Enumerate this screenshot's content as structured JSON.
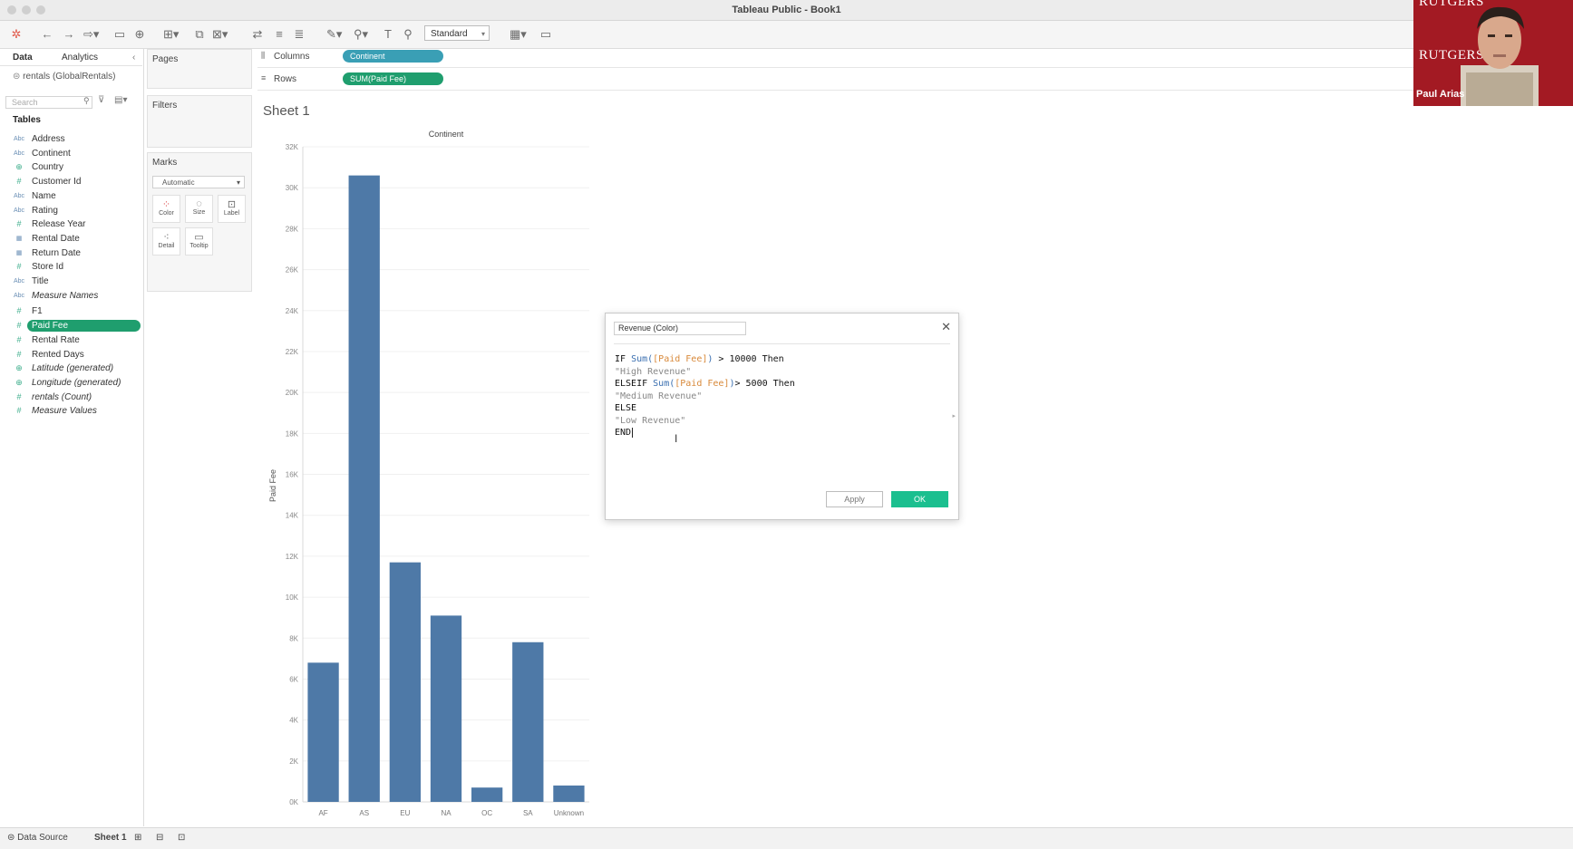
{
  "window": {
    "title": "Tableau Public - Book1"
  },
  "toolbar": {
    "view_select": "Standard"
  },
  "left_pane": {
    "tabs": [
      "Data",
      "Analytics"
    ],
    "data_source": "rentals (GlobalRentals)",
    "search_placeholder": "Search",
    "tables_heading": "Tables",
    "fields": [
      {
        "label": "Address",
        "icon": "Abc"
      },
      {
        "label": "Continent",
        "icon": "Abc"
      },
      {
        "label": "Country",
        "icon": "globe"
      },
      {
        "label": "Customer Id",
        "icon": "#"
      },
      {
        "label": "Name",
        "icon": "Abc"
      },
      {
        "label": "Rating",
        "icon": "Abc"
      },
      {
        "label": "Release Year",
        "icon": "#"
      },
      {
        "label": "Rental Date",
        "icon": "calendar"
      },
      {
        "label": "Return Date",
        "icon": "calendar"
      },
      {
        "label": "Store Id",
        "icon": "#"
      },
      {
        "label": "Title",
        "icon": "Abc"
      },
      {
        "label": "Measure Names",
        "icon": "Abc"
      },
      {
        "label": "F1",
        "icon": "#"
      },
      {
        "label": "Paid Fee",
        "icon": "#"
      },
      {
        "label": "Rental Rate",
        "icon": "#"
      },
      {
        "label": "Rented Days",
        "icon": "#"
      },
      {
        "label": "Latitude (generated)",
        "icon": "globe"
      },
      {
        "label": "Longitude (generated)",
        "icon": "globe"
      },
      {
        "label": "rentals (Count)",
        "icon": "#"
      },
      {
        "label": "Measure Values",
        "icon": "#"
      }
    ]
  },
  "shelves": {
    "pages": "Pages",
    "filters": "Filters",
    "marks": "Marks",
    "marks_type": "Automatic",
    "mark_buttons": [
      "Color",
      "Size",
      "Label",
      "Detail",
      "Tooltip"
    ],
    "columns_label": "Columns",
    "columns_pill": "Continent",
    "rows_label": "Rows",
    "rows_pill": "SUM(Paid Fee)"
  },
  "sheet": {
    "title": "Sheet 1"
  },
  "chart_data": {
    "type": "bar",
    "title": "Continent",
    "xlabel": "",
    "ylabel": "Paid Fee",
    "categories": [
      "AF",
      "AS",
      "EU",
      "NA",
      "OC",
      "SA",
      "Unknown"
    ],
    "values": [
      6800,
      30600,
      11700,
      9100,
      700,
      7800,
      800
    ],
    "ylim": [
      0,
      32000
    ],
    "yticks": [
      "0K",
      "2K",
      "4K",
      "6K",
      "8K",
      "10K",
      "12K",
      "14K",
      "16K",
      "18K",
      "20K",
      "22K",
      "24K",
      "26K",
      "28K",
      "30K",
      "32K"
    ],
    "bar_color": "#4e79a7",
    "grid": true
  },
  "dialog": {
    "name": "Revenue (Color)",
    "code_lines": [
      "IF Sum([Paid Fee]) > 10000 Then",
      "\"High Revenue\"",
      "ELSEIF Sum([Paid Fee])> 5000 Then",
      "\"Medium Revenue\"",
      "ELSE",
      "\"Low Revenue\"",
      "END"
    ],
    "apply": "Apply",
    "ok": "OK"
  },
  "webcam": {
    "name": "Paul Arias",
    "brand": "RUTGERS"
  },
  "bottom_tabs": {
    "data_source": "Data Source",
    "sheet": "Sheet 1"
  },
  "colors": {
    "accent": "#1bbf8f",
    "columns_pill": "#3a9fb5",
    "rows_pill": "#1f9e6e",
    "bar": "#4e79a7"
  }
}
